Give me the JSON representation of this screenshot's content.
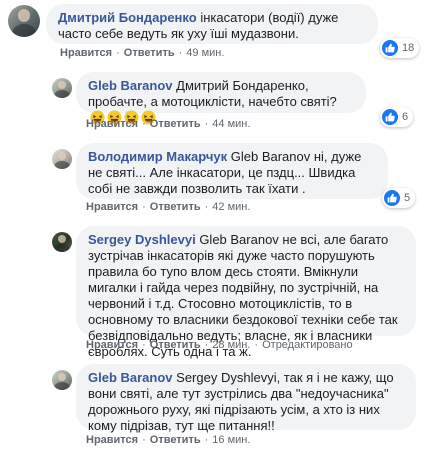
{
  "comments": [
    {
      "author": "Дмитрий Бондаренко",
      "text": "інкасатори (водії) дуже часто себе ведуть як уху їші мудазвони.",
      "actions": {
        "like": "Нравится",
        "reply": "Ответить",
        "time": "49 мин."
      },
      "reactions": {
        "count": "18",
        "icon": "like-icon"
      }
    },
    {
      "author": "Gleb Baranov",
      "text": "Дмитрий Бондаренко, пробачте, а мотоциклісти, начебто святі?",
      "emoji": [
        "laughing-icon",
        "laughing-icon",
        "laughing-icon",
        "laughing-icon"
      ],
      "actions": {
        "like": "Нравится",
        "reply": "Ответить",
        "time": "44 мин."
      },
      "reactions": {
        "count": "6",
        "icon": "like-icon"
      }
    },
    {
      "author": "Володимир Макарчук",
      "text": "Gleb Baranov ні, дуже не святі... Але інкасатори, це пздц... Швидка собі не завжди позволить так їхати .",
      "actions": {
        "like": "Нравится",
        "reply": "Ответить",
        "time": "42 мин."
      },
      "reactions": {
        "count": "5",
        "icon": "like-icon"
      }
    },
    {
      "author": "Sergey Dyshlevyi",
      "text": "Gleb Baranov не всі, але багато зустрічав інкасаторів які дуже часто порушують правила бо тупо влом десь стояти. Вмікнули мигалки і гайда через подвійну, по зустрічній, на червоний і т.д. Стосовно мотоциклістів, то в основному то власники бездокової техніки себе так безвідповідально ведуть; власне, як і власники євроблях. Суть одна і та ж.",
      "actions": {
        "like": "Нравится",
        "reply": "Ответить",
        "time": "28 мин.",
        "edited": "Отредактировано"
      },
      "reactions": null
    },
    {
      "author": "Gleb Baranov",
      "text": "Sergey Dyshlevyi, так я і не кажу, що вони святі, але тут зустрілись два \"недоучасника\" дорожнього руху, які підрізають усім, а хто із них кому підрізав, тут ще питання!!",
      "actions": {
        "like": "Нравится",
        "reply": "Ответить",
        "time": "16 мин."
      },
      "reactions": null
    }
  ],
  "colors": {
    "author": "#385898",
    "bubble": "#f2f3f5",
    "like": "#1877f2",
    "meta": "#606770"
  }
}
